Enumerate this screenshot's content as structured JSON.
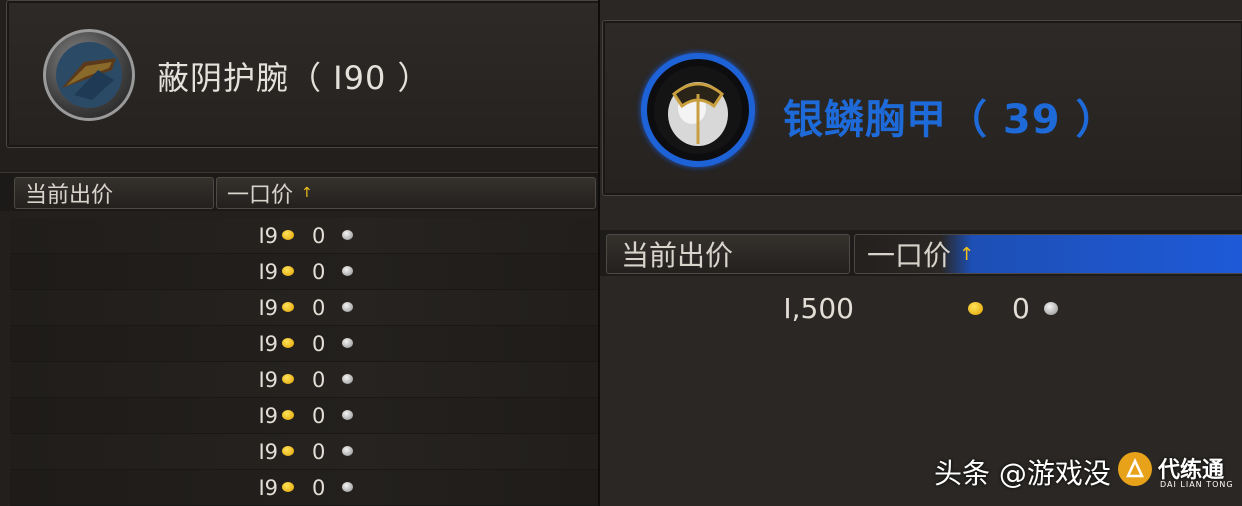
{
  "left_listing": {
    "item_name": "蔽阴护腕（ I90 ）",
    "item_icon": "bracer-icon",
    "columns": {
      "current_bid": "当前出价",
      "buyout": "一口价",
      "sort_arrow": "↑"
    },
    "rows": [
      {
        "gold": "I9",
        "silver": "0"
      },
      {
        "gold": "I9",
        "silver": "0"
      },
      {
        "gold": "I9",
        "silver": "0"
      },
      {
        "gold": "I9",
        "silver": "0"
      },
      {
        "gold": "I9",
        "silver": "0"
      },
      {
        "gold": "I9",
        "silver": "0"
      },
      {
        "gold": "I9",
        "silver": "0"
      },
      {
        "gold": "I9",
        "silver": "0"
      }
    ]
  },
  "right_listing": {
    "item_name": "银鳞胸甲（ 39 ）",
    "item_icon": "chest-armor-icon",
    "quality_color": "#1e6ad8",
    "columns": {
      "current_bid": "当前出价",
      "buyout": "一口价",
      "sort_arrow": "↑"
    },
    "rows": [
      {
        "gold": "I,500",
        "silver": "0"
      }
    ]
  },
  "watermark": {
    "text": "头条 @游戏没",
    "brand": "代练通",
    "brand_sub": "DAI LIAN TONG"
  }
}
